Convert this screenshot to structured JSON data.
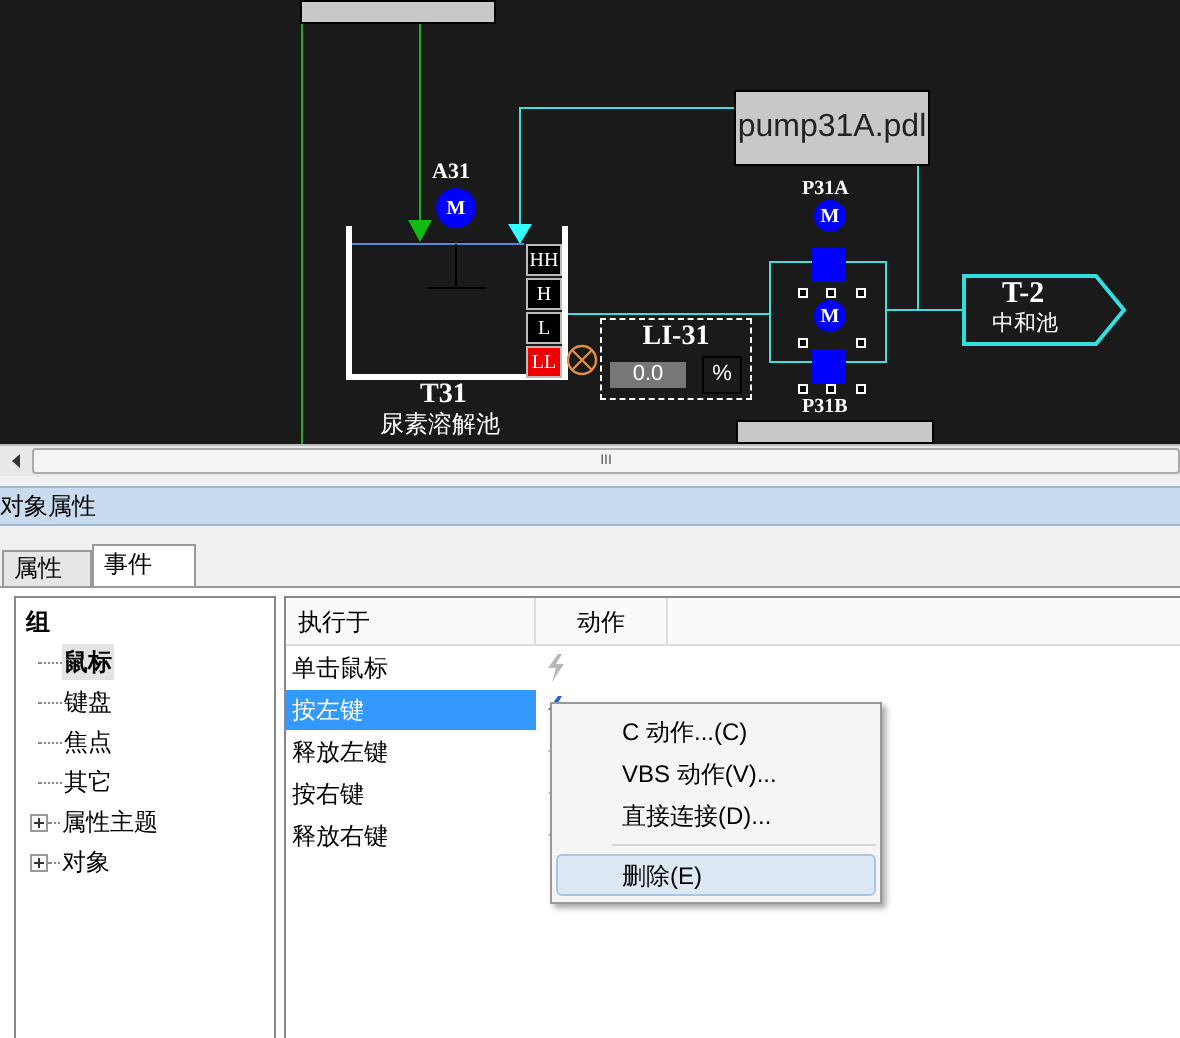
{
  "canvas": {
    "file_box": {
      "label": "pump31A.pdl"
    },
    "agitator": {
      "tag": "A31",
      "symbol": "M"
    },
    "tank": {
      "tag": "T31",
      "name": "尿素溶解池",
      "switches": [
        {
          "label": "HH",
          "alarm": false
        },
        {
          "label": "H",
          "alarm": false
        },
        {
          "label": "L",
          "alarm": false
        },
        {
          "label": "LL",
          "alarm": true
        }
      ]
    },
    "level_indicator": {
      "tag": "LI-31",
      "value": "0.0",
      "unit": "%"
    },
    "pump": {
      "tag_a": "P31A",
      "tag_b": "P31B",
      "symbol_a": "M",
      "symbol_b": "M"
    },
    "target": {
      "tag": "T-2",
      "name": "中和池"
    }
  },
  "scrollbar": {
    "grip": "III"
  },
  "panel": {
    "title": "对象属性",
    "tabs": [
      {
        "label": "属性",
        "selected": false
      },
      {
        "label": "事件",
        "selected": true
      }
    ],
    "tree": {
      "label": "组",
      "children": [
        {
          "kind": "leaf",
          "label": "鼠标",
          "selected": true
        },
        {
          "kind": "leaf",
          "label": "键盘",
          "selected": false
        },
        {
          "kind": "leaf",
          "label": "焦点",
          "selected": false
        },
        {
          "kind": "leaf",
          "label": "其它",
          "selected": false
        },
        {
          "kind": "branch",
          "label": "属性主题",
          "selected": false,
          "expanded": false
        },
        {
          "kind": "branch",
          "label": "对象",
          "selected": false,
          "expanded": false
        }
      ]
    },
    "table": {
      "columns": [
        "执行于",
        "动作"
      ],
      "rows": [
        {
          "event": "单击鼠标",
          "selected": false
        },
        {
          "event": "按左键",
          "selected": true
        },
        {
          "event": "释放左键",
          "selected": false
        },
        {
          "event": "按右键",
          "selected": false
        },
        {
          "event": "释放右键",
          "selected": false
        }
      ]
    },
    "context_menu": {
      "items": [
        {
          "kind": "item",
          "label": "C 动作...(C)",
          "selected": false
        },
        {
          "kind": "item",
          "label": "VBS 动作(V)...",
          "selected": false
        },
        {
          "kind": "item",
          "label": "直接连接(D)...",
          "selected": false
        },
        {
          "kind": "separator"
        },
        {
          "kind": "item",
          "label": "删除(E)",
          "selected": true
        }
      ]
    }
  }
}
